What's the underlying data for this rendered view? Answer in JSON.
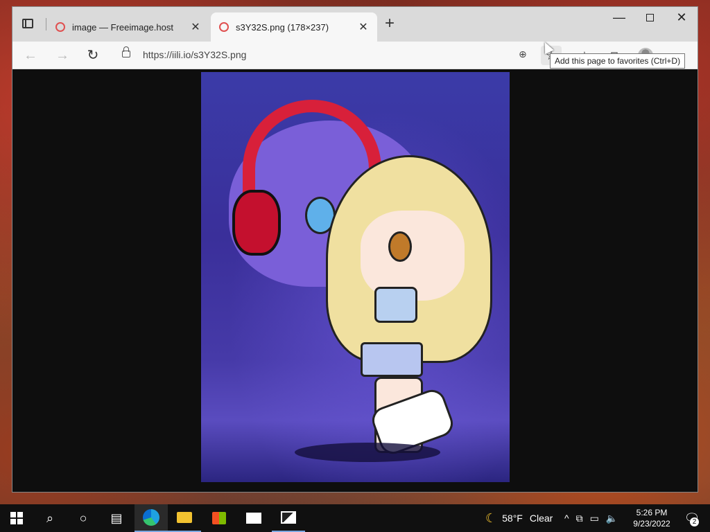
{
  "browser": {
    "tabs": [
      {
        "label": "image — Freeimage.host",
        "active": false
      },
      {
        "label": "s3Y32S.png (178×237)",
        "active": true
      }
    ],
    "url": "https://iili.io/s3Y32S.png",
    "tooltip": "Add this page to favorites (Ctrl+D)",
    "window_controls": {
      "minimize": "—",
      "maximize": "",
      "close": "✕"
    },
    "new_tab": "+",
    "icons": {
      "back": "←",
      "forward": "→",
      "refresh": "↻",
      "zoom": "⊕",
      "favorites_add": "☆",
      "favorites": "☆",
      "collections": "⧉",
      "more": "···"
    }
  },
  "taskbar": {
    "weather": {
      "temp": "58°F",
      "condition": "Clear"
    },
    "time": "5:26 PM",
    "date": "9/23/2022",
    "notifications_count": "2",
    "tray_icons": {
      "chevron": "^",
      "meet": "⧉",
      "network": "▭",
      "volume": "🔈"
    }
  }
}
